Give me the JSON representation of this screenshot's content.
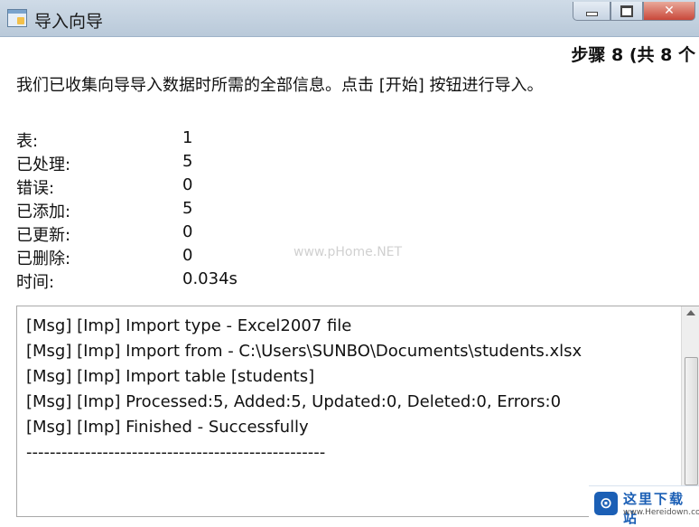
{
  "window": {
    "title": "导入向导",
    "close_glyph": "✕"
  },
  "step_label": "步骤 8 (共 8 个",
  "intro": "我们已收集向导导入数据时所需的全部信息。点击 [开始] 按钮进行导入。",
  "stats": [
    {
      "label": "表:",
      "value": "1"
    },
    {
      "label": "已处理:",
      "value": "5"
    },
    {
      "label": "错误:",
      "value": "0"
    },
    {
      "label": "已添加:",
      "value": "5"
    },
    {
      "label": "已更新:",
      "value": "0"
    },
    {
      "label": "已删除:",
      "value": "0"
    },
    {
      "label": "时间:",
      "value": "0.034s"
    }
  ],
  "log": [
    "[Msg] [Imp] Import type - Excel2007 file",
    "[Msg] [Imp] Import from - C:\\Users\\SUNBO\\Documents\\students.xlsx",
    "[Msg] [Imp] Import table [students]",
    "[Msg] [Imp] Processed:5, Added:5, Updated:0, Deleted:0, Errors:0",
    "[Msg] [Imp] Finished - Successfully",
    "---------------------------------------------------"
  ],
  "watermark": "www.pHome.NET",
  "badge": {
    "logo_glyph": "⊙",
    "name": "这里下载站",
    "url": "www.Hereidown.com"
  },
  "colors": {
    "titlebar": "#c3d1e0",
    "close_button": "#c9483a",
    "badge_blue": "#1b5fb5"
  },
  "icons": [
    "app-icon",
    "minimize-icon",
    "maximize-icon",
    "close-icon",
    "scroll-up-arrow-icon",
    "site-logo-icon"
  ]
}
